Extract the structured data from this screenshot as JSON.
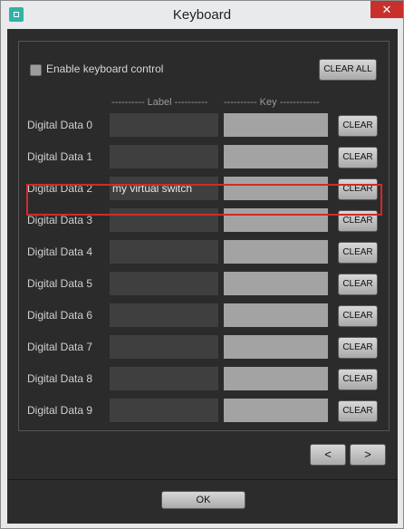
{
  "window": {
    "title": "Keyboard",
    "close_glyph": "✕"
  },
  "options": {
    "enable_label": "Enable keyboard control",
    "enable_checked": false
  },
  "buttons": {
    "clear_all": "CLEAR ALL",
    "prev": "<",
    "next": ">",
    "ok": "OK"
  },
  "columns": {
    "label_header": "---------- Label ----------",
    "key_header": "---------- Key ------------"
  },
  "rows": [
    {
      "name": "Digital Data 0",
      "label_value": "",
      "key_value": "",
      "clear": "CLEAR"
    },
    {
      "name": "Digital Data 1",
      "label_value": "",
      "key_value": "",
      "clear": "CLEAR"
    },
    {
      "name": "Digital Data 2",
      "label_value": "my virtual switch",
      "key_value": "",
      "clear": "CLEAR"
    },
    {
      "name": "Digital Data 3",
      "label_value": "",
      "key_value": "",
      "clear": "CLEAR"
    },
    {
      "name": "Digital Data 4",
      "label_value": "",
      "key_value": "",
      "clear": "CLEAR"
    },
    {
      "name": "Digital Data 5",
      "label_value": "",
      "key_value": "",
      "clear": "CLEAR"
    },
    {
      "name": "Digital Data 6",
      "label_value": "",
      "key_value": "",
      "clear": "CLEAR"
    },
    {
      "name": "Digital Data 7",
      "label_value": "",
      "key_value": "",
      "clear": "CLEAR"
    },
    {
      "name": "Digital Data 8",
      "label_value": "",
      "key_value": "",
      "clear": "CLEAR"
    },
    {
      "name": "Digital Data 9",
      "label_value": "",
      "key_value": "",
      "clear": "CLEAR"
    }
  ],
  "colors": {
    "highlight": "#d22a2a",
    "client_bg": "#2c2c2c",
    "close_bg": "#c7302b"
  }
}
